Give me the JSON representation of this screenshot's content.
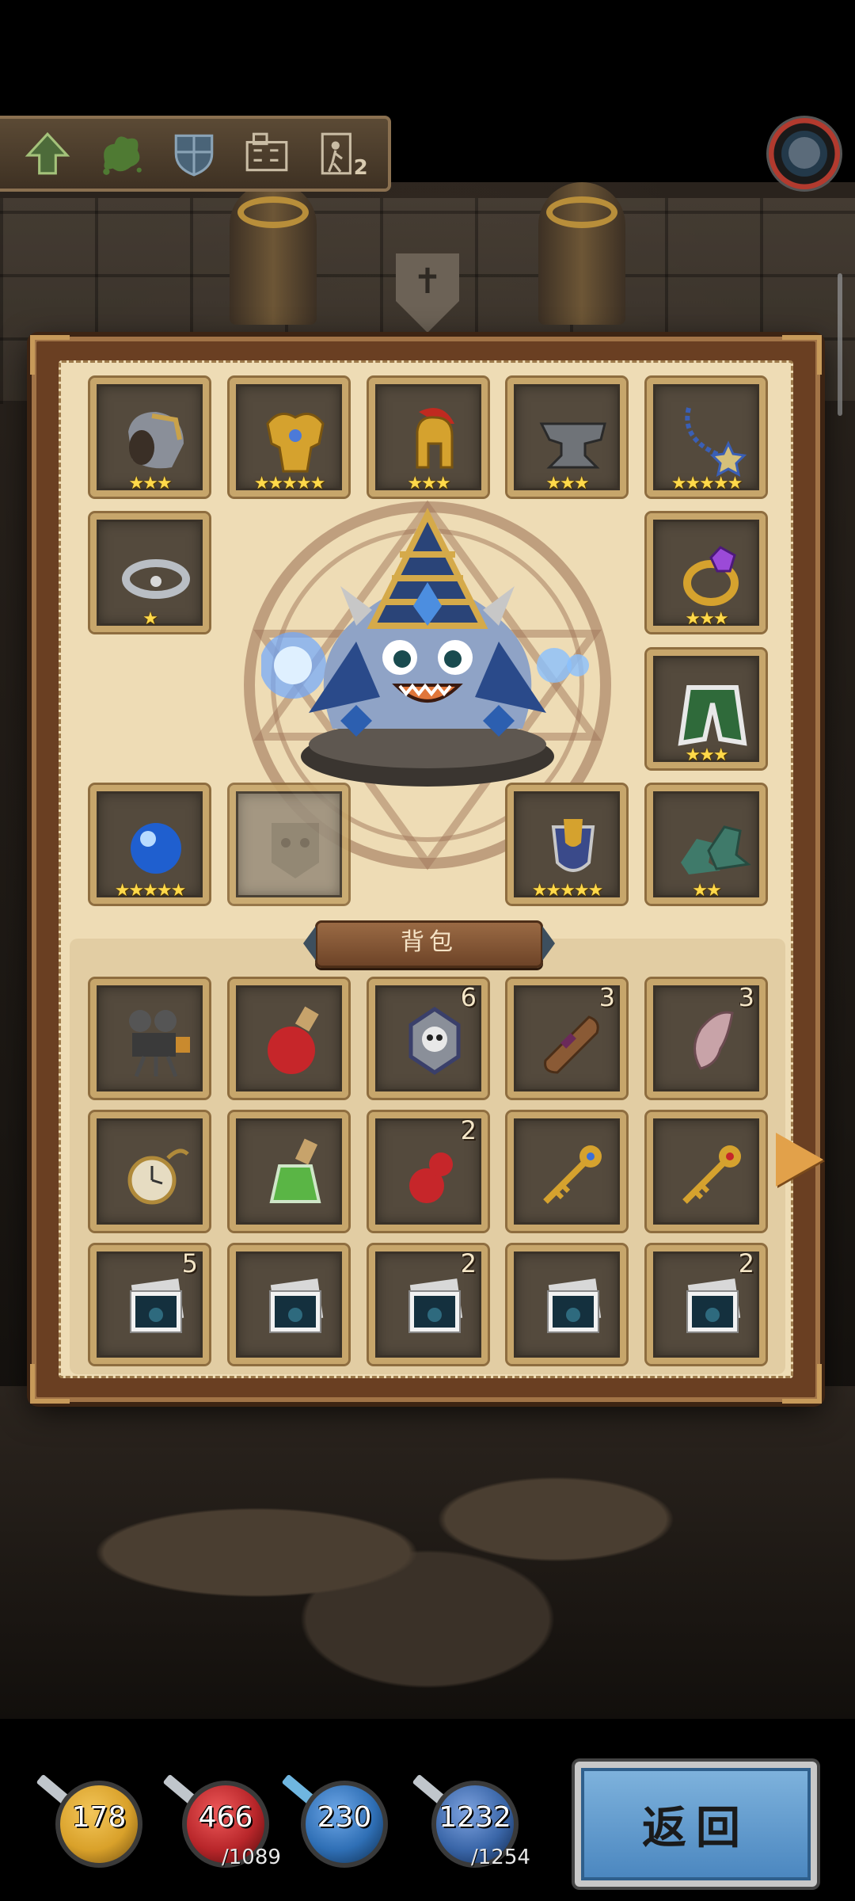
{
  "toolbar": {
    "items": [
      {
        "name": "upgrade",
        "icon": "up-arrow-icon"
      },
      {
        "name": "splash",
        "icon": "splash-icon"
      },
      {
        "name": "shield",
        "icon": "shield-icon"
      },
      {
        "name": "map",
        "icon": "map-icon"
      },
      {
        "name": "quest",
        "icon": "quest-icon",
        "badge": "2"
      }
    ]
  },
  "equipment": {
    "slots": [
      {
        "name": "vambrace",
        "icon": "vambrace-icon",
        "stars": "★★★"
      },
      {
        "name": "golden-armor",
        "icon": "golden-armor-icon",
        "stars": "★★★★★"
      },
      {
        "name": "spartan-helmet",
        "icon": "spartan-helmet-icon",
        "stars": "★★★"
      },
      {
        "name": "anvil",
        "icon": "anvil-icon",
        "stars": "★★★"
      },
      {
        "name": "star-amulet",
        "icon": "amulet-icon",
        "stars": "★★★★★"
      },
      {
        "name": "silver-ring",
        "icon": "silver-ring-icon",
        "stars": "★"
      },
      {
        "name": "gem-ring",
        "icon": "gem-ring-icon",
        "stars": "★★★"
      },
      {
        "name": "fur-cloak",
        "icon": "cloak-icon",
        "stars": "★★★"
      },
      {
        "name": "blue-orb",
        "icon": "orb-icon",
        "stars": "★★★★★"
      },
      {
        "name": "empty-slot",
        "icon": "empty-face-icon",
        "stars": ""
      },
      {
        "name": "trophy-badge",
        "icon": "trophy-icon",
        "stars": "★★★★★"
      },
      {
        "name": "green-boots",
        "icon": "boots-icon",
        "stars": "★★"
      }
    ]
  },
  "bag": {
    "label": "背包",
    "items": [
      {
        "name": "film-camera",
        "icon": "film-camera-icon",
        "count": ""
      },
      {
        "name": "red-potion",
        "icon": "red-potion-icon",
        "count": ""
      },
      {
        "name": "skull-emblem",
        "icon": "skull-emblem-icon",
        "count": "6"
      },
      {
        "name": "scroll",
        "icon": "scroll-icon",
        "count": "3"
      },
      {
        "name": "elf-ear",
        "icon": "ear-icon",
        "count": "3"
      },
      {
        "name": "pocket-watch",
        "icon": "pocket-watch-icon",
        "count": ""
      },
      {
        "name": "green-potion",
        "icon": "green-potion-icon",
        "count": ""
      },
      {
        "name": "red-gourd",
        "icon": "gourd-icon",
        "count": "2"
      },
      {
        "name": "blue-key",
        "icon": "key-icon",
        "count": ""
      },
      {
        "name": "red-key",
        "icon": "key-icon",
        "count": ""
      },
      {
        "name": "photo-card",
        "icon": "photo-card-icon",
        "count": "5"
      },
      {
        "name": "photo-card",
        "icon": "photo-card-icon",
        "count": ""
      },
      {
        "name": "photo-card",
        "icon": "photo-card-icon",
        "count": "2"
      },
      {
        "name": "photo-card",
        "icon": "photo-card-icon",
        "count": ""
      },
      {
        "name": "photo-card",
        "icon": "photo-card-icon",
        "count": "2"
      }
    ]
  },
  "resources": [
    {
      "name": "attack",
      "value": "178",
      "max": "",
      "color": "#d9a12a"
    },
    {
      "name": "health",
      "value": "466",
      "max": "/1089",
      "color": "#b8262a"
    },
    {
      "name": "magic",
      "value": "230",
      "max": "",
      "color": "#2f6fb5"
    },
    {
      "name": "mana",
      "value": "1232",
      "max": "/1254",
      "color": "#3a66a8"
    }
  ],
  "return_button": {
    "label": "返回"
  }
}
